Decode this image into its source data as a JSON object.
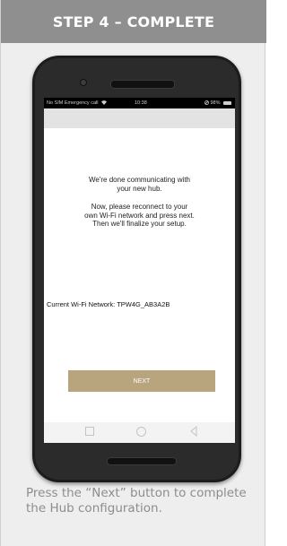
{
  "header": {
    "title": "STEP 4 – COMPLETE"
  },
  "phone": {
    "status_bar": {
      "left": "No SIM  Emergency call",
      "time": "10:38",
      "battery": "98%",
      "icons": [
        "wifi-icon",
        "signal-off-icon",
        "battery-icon"
      ]
    },
    "screen": {
      "message_line1": "We're done communicating with your new hub.",
      "message_line2": "Now, please reconnect to your own Wi-Fi network and press next. Then we'll finalize your setup.",
      "wifi_label": "Current Wi-Fi Network: TPW4G_AB3A2B",
      "next_label": "NEXT",
      "next_color": "#b9a57d"
    },
    "nav_icons": [
      "square-icon",
      "circle-home-icon",
      "triangle-back-icon"
    ]
  },
  "caption": "Press the “Next” button to complete the Hub configuration.",
  "colors": {
    "header_bg": "#8f8f8f",
    "card_bg": "#eeeeee",
    "caption_text": "#8d8d8d"
  }
}
